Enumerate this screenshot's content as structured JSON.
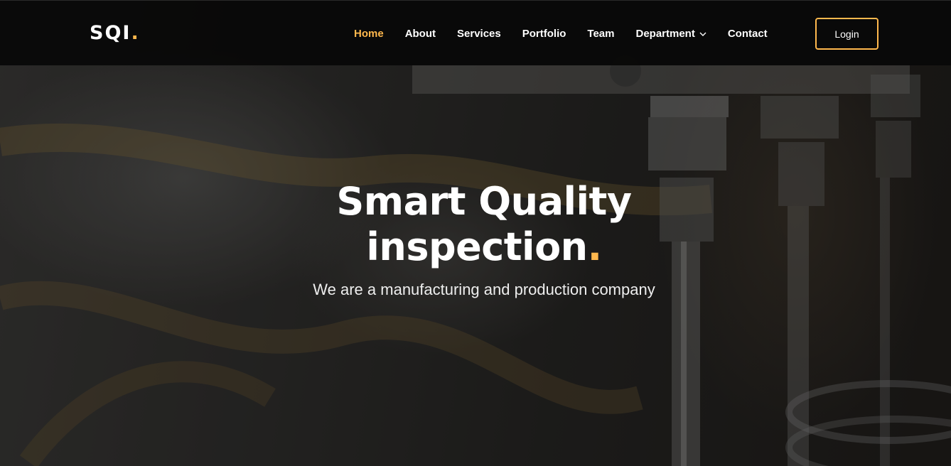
{
  "header": {
    "logo_text": "SQI",
    "logo_dot": ".",
    "nav": [
      {
        "label": "Home"
      },
      {
        "label": "About"
      },
      {
        "label": "Services"
      },
      {
        "label": "Portfolio"
      },
      {
        "label": "Team"
      },
      {
        "label": "Department"
      },
      {
        "label": "Contact"
      }
    ],
    "login_label": "Login"
  },
  "hero": {
    "title_line1": "Smart Quality",
    "title_line2": "inspection",
    "title_dot": ".",
    "subtitle": "We are a manufacturing and production company"
  },
  "theme": {
    "accent": "#ffb84d",
    "header_bg": "#080808",
    "text": "#ffffff"
  },
  "icons": {
    "dropdown": "chevron-down-icon"
  }
}
